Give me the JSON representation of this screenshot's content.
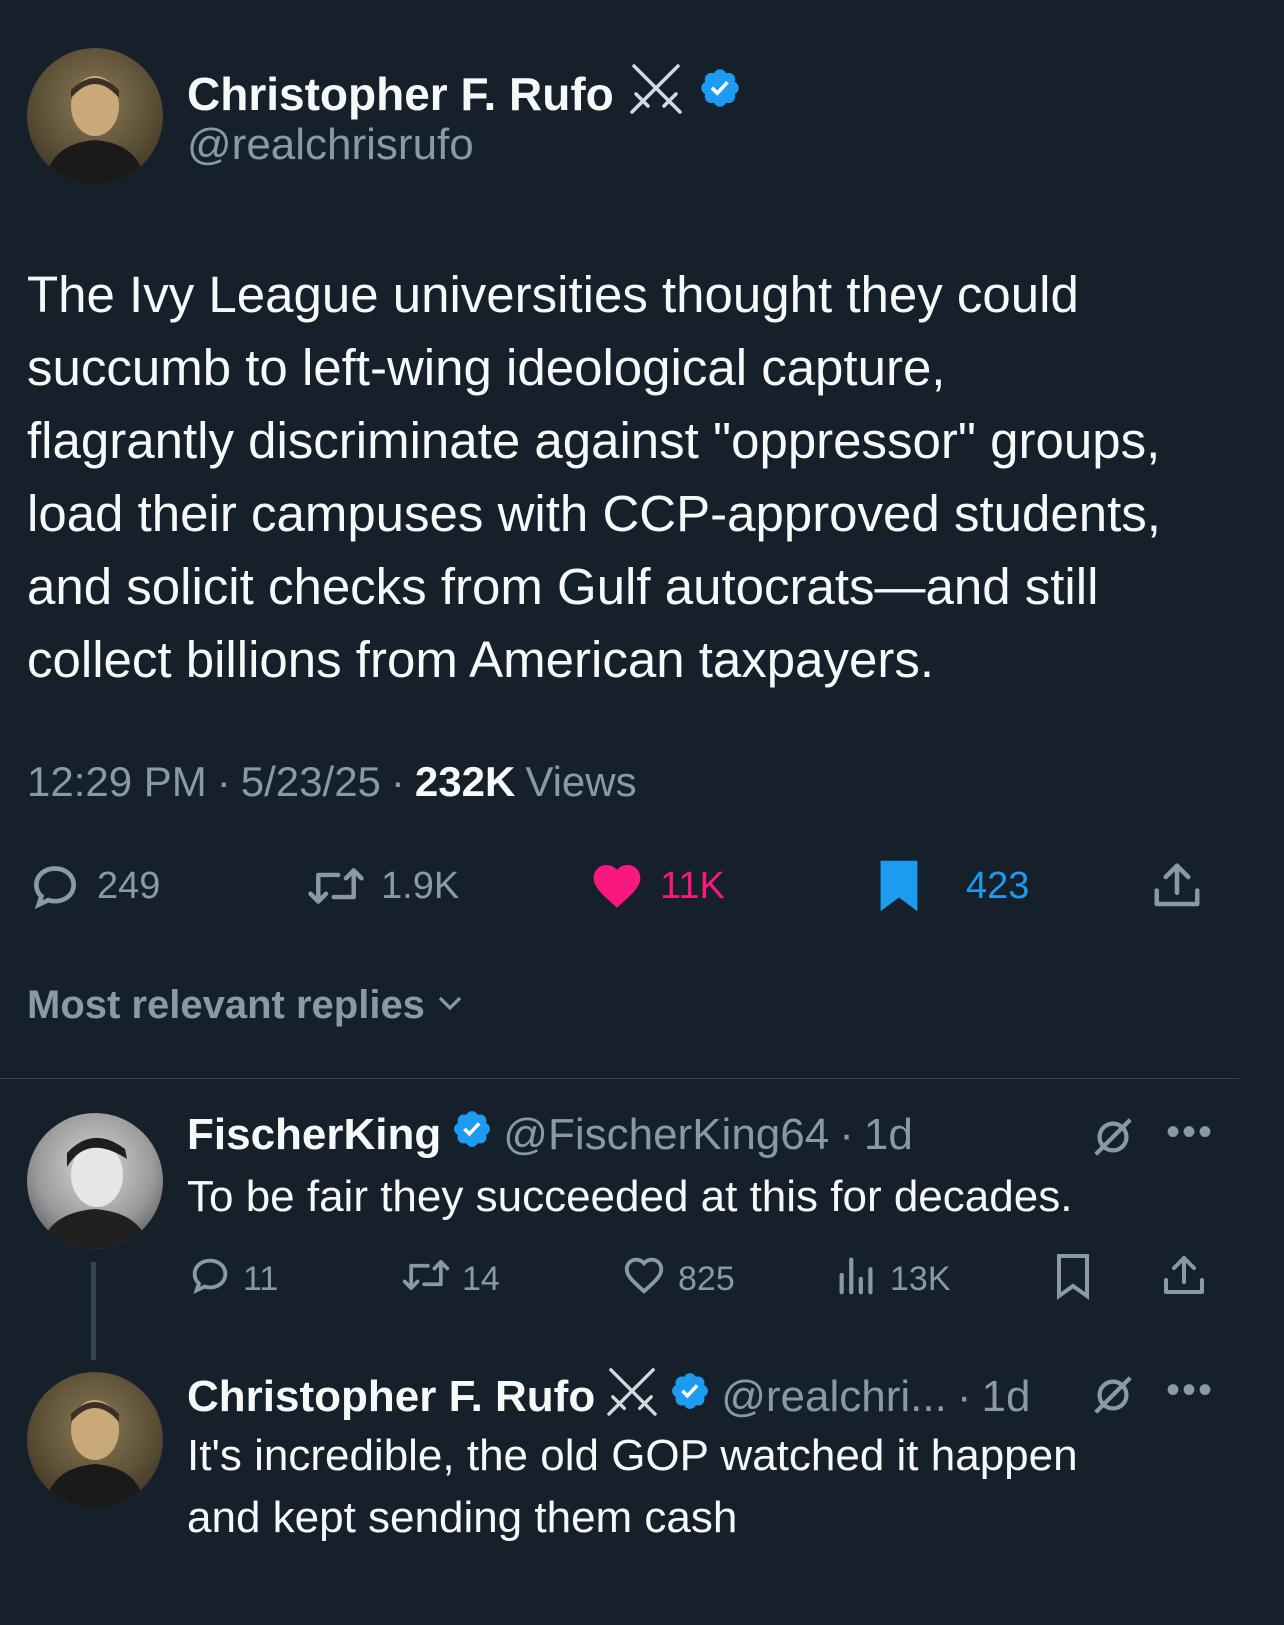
{
  "main_tweet": {
    "author_name": "Christopher F. Rufo",
    "author_badge_icon": "crossed-swords-icon",
    "handle": "@realchrisrufo",
    "text_lines": [
      "The Ivy League universities thought they could",
      "succumb to left-wing ideological capture,",
      "flagrantly discriminate against \"oppressor\" groups,",
      "load their campuses with CCP-approved students,",
      "and solicit checks from Gulf autocrats—and still",
      "collect billions from American taxpayers."
    ],
    "time": "12:29 PM",
    "sep": "·",
    "date": "5/23/25",
    "views_count": "232K",
    "views_label": "Views",
    "replies": "249",
    "retweets": "1.9K",
    "likes": "11K",
    "bookmarks": "423"
  },
  "replies_header": {
    "label": "Most relevant replies"
  },
  "replies": [
    {
      "author_name": "FischerKing",
      "handle": "@FischerKing64",
      "sep": "·",
      "time": "1d",
      "text": "To be fair they succeeded at this for decades.",
      "replies": "11",
      "retweets": "14",
      "likes": "825",
      "views": "13K"
    },
    {
      "author_name": "Christopher F. Rufo",
      "handle": "@realchri...",
      "sep": "·",
      "time": "1d",
      "text_lines": [
        "It's incredible, the old GOP watched it happen",
        "and kept sending them cash"
      ]
    }
  ],
  "colors": {
    "background": "#15202b",
    "verified_blue": "#1d9bf0",
    "like_pink": "#f91880",
    "secondary_text": "#8b98a5"
  }
}
